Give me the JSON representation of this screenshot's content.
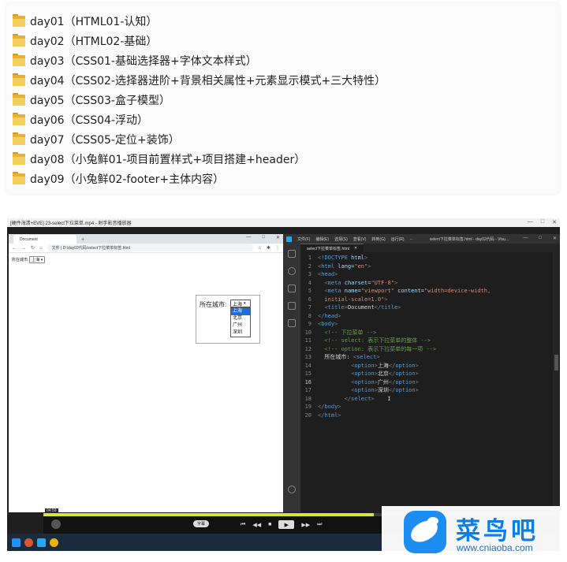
{
  "folders": [
    "day01（HTML01-认知）",
    "day02（HTML02-基础）",
    "day03（CSS01-基础选择器+字体文本样式）",
    "day04（CSS02-选择器进阶+背景相关属性+元素显示模式+三大特性）",
    "day05（CSS03-盒子模型）",
    "day06（CSS04-浮动）",
    "day07（CSS05-定位+装饰）",
    "day08（小兔鲜01-项目前置样式+项目搭建+header）",
    "day09（小兔鲜02-footer+主体内容）"
  ],
  "capture": {
    "title": "[硬件海清+EVE] 23-select下拉菜单.mp4 - 射手影音播放器",
    "browser": {
      "tab_title": "Document",
      "url": "文件 | D:/day02代码/select下拉菜单标签.html",
      "small_label": "所在城市:",
      "small_selected": "上海",
      "zoom_label": "所在城市:",
      "zoom_selected": "上海",
      "options": [
        "上海",
        "北京",
        "广州",
        "深圳"
      ]
    },
    "vscode": {
      "menu": [
        "文件(F)",
        "编辑(E)",
        "选择(S)",
        "查看(V)",
        "转到(G)",
        "运行(R)",
        "..."
      ],
      "window_title": "select下拉菜单标签.html - day02代码 - Visu...",
      "tab": "select下拉菜单标签.html",
      "current_line": 16,
      "lines": [
        [
          {
            "c": "#808080",
            "t": "<!"
          },
          {
            "c": "#569cd6",
            "t": "DOCTYPE"
          },
          {
            "c": "#9cdcfe",
            "t": " html"
          },
          {
            "c": "#808080",
            "t": ">"
          }
        ],
        [
          {
            "c": "#808080",
            "t": "<"
          },
          {
            "c": "#569cd6",
            "t": "html"
          },
          {
            "c": "#9cdcfe",
            "t": " lang"
          },
          {
            "c": "#d4d4d4",
            "t": "="
          },
          {
            "c": "#ce9178",
            "t": "\"en\""
          },
          {
            "c": "#808080",
            "t": ">"
          }
        ],
        [
          {
            "c": "#808080",
            "t": "<"
          },
          {
            "c": "#569cd6",
            "t": "head"
          },
          {
            "c": "#808080",
            "t": ">"
          }
        ],
        [
          {
            "c": "#d4d4d4",
            "t": "  "
          },
          {
            "c": "#808080",
            "t": "<"
          },
          {
            "c": "#569cd6",
            "t": "meta"
          },
          {
            "c": "#9cdcfe",
            "t": " charset"
          },
          {
            "c": "#d4d4d4",
            "t": "="
          },
          {
            "c": "#ce9178",
            "t": "\"UTF-8\""
          },
          {
            "c": "#808080",
            "t": ">"
          }
        ],
        [
          {
            "c": "#d4d4d4",
            "t": "  "
          },
          {
            "c": "#808080",
            "t": "<"
          },
          {
            "c": "#569cd6",
            "t": "meta"
          },
          {
            "c": "#9cdcfe",
            "t": " name"
          },
          {
            "c": "#d4d4d4",
            "t": "="
          },
          {
            "c": "#ce9178",
            "t": "\"viewport\""
          },
          {
            "c": "#9cdcfe",
            "t": " content"
          },
          {
            "c": "#d4d4d4",
            "t": "="
          },
          {
            "c": "#ce9178",
            "t": "\"width=device-width,"
          }
        ],
        [
          {
            "c": "#ce9178",
            "t": "  initial-scale=1.0\""
          },
          {
            "c": "#808080",
            "t": ">"
          }
        ],
        [
          {
            "c": "#d4d4d4",
            "t": "  "
          },
          {
            "c": "#808080",
            "t": "<"
          },
          {
            "c": "#569cd6",
            "t": "title"
          },
          {
            "c": "#808080",
            "t": ">"
          },
          {
            "c": "#d4d4d4",
            "t": "Document"
          },
          {
            "c": "#808080",
            "t": "</"
          },
          {
            "c": "#569cd6",
            "t": "title"
          },
          {
            "c": "#808080",
            "t": ">"
          }
        ],
        [
          {
            "c": "#808080",
            "t": "</"
          },
          {
            "c": "#569cd6",
            "t": "head"
          },
          {
            "c": "#808080",
            "t": ">"
          }
        ],
        [
          {
            "c": "#808080",
            "t": "<"
          },
          {
            "c": "#569cd6",
            "t": "body"
          },
          {
            "c": "#808080",
            "t": ">"
          }
        ],
        [
          {
            "c": "#6a9955",
            "t": "  <!-- 下拉菜单 -->"
          }
        ],
        [
          {
            "c": "#6a9955",
            "t": "  <!-- select: 表示下拉菜单的整体 -->"
          }
        ],
        [
          {
            "c": "#6a9955",
            "t": "  <!-- option: 表示下拉菜单的每一项 -->"
          }
        ],
        [
          {
            "c": "#d4d4d4",
            "t": "  所在城市: "
          },
          {
            "c": "#808080",
            "t": "<"
          },
          {
            "c": "#569cd6",
            "t": "select"
          },
          {
            "c": "#808080",
            "t": ">"
          }
        ],
        [
          {
            "c": "#d4d4d4",
            "t": "          "
          },
          {
            "c": "#808080",
            "t": "<"
          },
          {
            "c": "#569cd6",
            "t": "option"
          },
          {
            "c": "#808080",
            "t": ">"
          },
          {
            "c": "#d4d4d4",
            "t": "上海"
          },
          {
            "c": "#808080",
            "t": "</"
          },
          {
            "c": "#569cd6",
            "t": "option"
          },
          {
            "c": "#808080",
            "t": ">"
          }
        ],
        [
          {
            "c": "#d4d4d4",
            "t": "          "
          },
          {
            "c": "#808080",
            "t": "<"
          },
          {
            "c": "#569cd6",
            "t": "option"
          },
          {
            "c": "#808080",
            "t": ">"
          },
          {
            "c": "#d4d4d4",
            "t": "北京"
          },
          {
            "c": "#808080",
            "t": "</"
          },
          {
            "c": "#569cd6",
            "t": "option"
          },
          {
            "c": "#808080",
            "t": ">"
          }
        ],
        [
          {
            "c": "#d4d4d4",
            "t": "          "
          },
          {
            "c": "#808080",
            "t": "<"
          },
          {
            "c": "#569cd6",
            "t": "option"
          },
          {
            "c": "#808080",
            "t": ">"
          },
          {
            "c": "#d4d4d4",
            "t": "广州"
          },
          {
            "c": "#808080",
            "t": "</"
          },
          {
            "c": "#569cd6",
            "t": "option"
          },
          {
            "c": "#808080",
            "t": ">"
          }
        ],
        [
          {
            "c": "#d4d4d4",
            "t": "          "
          },
          {
            "c": "#808080",
            "t": "<"
          },
          {
            "c": "#569cd6",
            "t": "option"
          },
          {
            "c": "#808080",
            "t": ">"
          },
          {
            "c": "#d4d4d4",
            "t": "深圳"
          },
          {
            "c": "#808080",
            "t": "</"
          },
          {
            "c": "#569cd6",
            "t": "option"
          },
          {
            "c": "#808080",
            "t": ">"
          }
        ],
        [
          {
            "c": "#d4d4d4",
            "t": "        "
          },
          {
            "c": "#808080",
            "t": "</"
          },
          {
            "c": "#569cd6",
            "t": "select"
          },
          {
            "c": "#808080",
            "t": ">"
          },
          {
            "c": "#d4d4d4",
            "t": "    I"
          }
        ],
        [
          {
            "c": "#808080",
            "t": "</"
          },
          {
            "c": "#569cd6",
            "t": "body"
          },
          {
            "c": "#808080",
            "t": ">"
          }
        ],
        [
          {
            "c": "#808080",
            "t": "</"
          },
          {
            "c": "#569cd6",
            "t": "html"
          },
          {
            "c": "#808080",
            "t": ">"
          }
        ]
      ]
    },
    "player": {
      "time": "04:59",
      "subtitle_button": "字幕",
      "progress": 0.64,
      "controls": [
        "⏮",
        "◀◀",
        "■",
        "▶",
        "▶▶",
        "⏭"
      ]
    }
  },
  "watermark": {
    "title": "菜鸟吧",
    "url": "www.cniaoba.com",
    "brand_color": "#1c8df1"
  }
}
